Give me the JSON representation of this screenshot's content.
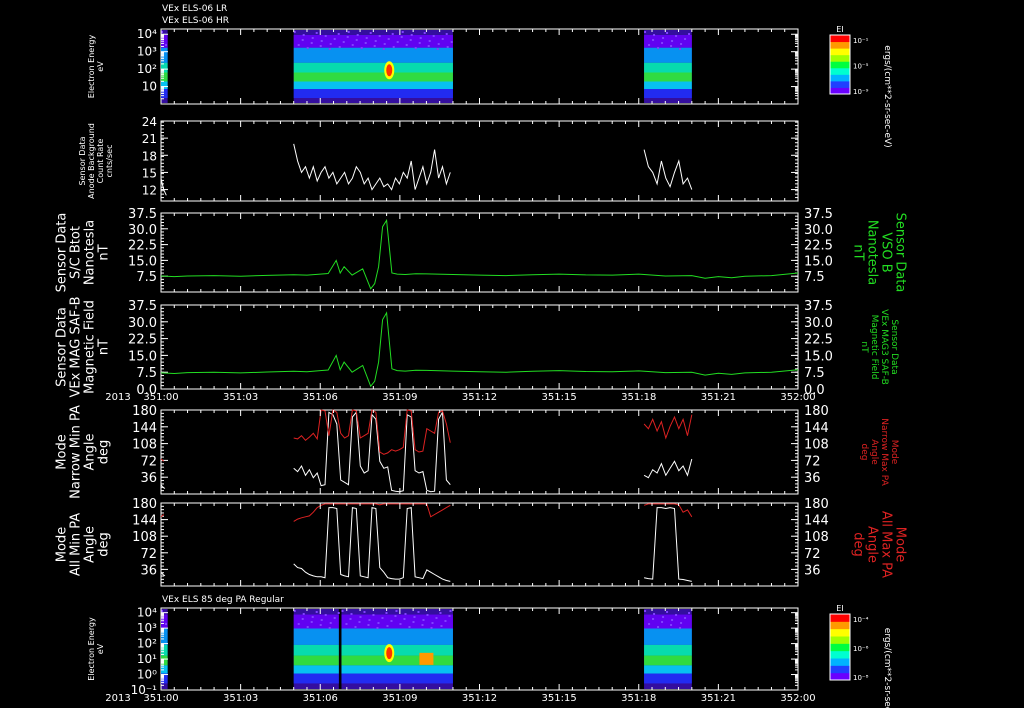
{
  "header": {
    "line1": "VEx ELS-06 LR",
    "line2": "VEx ELS-06 HR"
  },
  "colors": {
    "white": "#ffffff",
    "green": "#22dd22",
    "red": "#dd2222",
    "background": "#000000"
  },
  "time_axis": {
    "year_label": "2013",
    "ticks": [
      "351:00",
      "351:03",
      "351:06",
      "351:09",
      "351:12",
      "351:15",
      "351:18",
      "351:21",
      "352:00"
    ],
    "tick_hours": [
      0,
      3,
      6,
      9,
      12,
      15,
      18,
      21,
      24
    ],
    "range": [
      0,
      24
    ]
  },
  "chart_data": [
    {
      "type": "heatmap",
      "id": "els-lr-hr",
      "ylabel_lines": [
        "Electron Energy",
        "eV"
      ],
      "y_scale": "log",
      "ylim": [
        1,
        20000
      ],
      "y_ticks": [
        "10",
        "10²",
        "10³",
        "10⁴"
      ],
      "y_tick_values": [
        10,
        100,
        1000,
        10000
      ],
      "data_intervals_hours": [
        [
          0,
          0.25
        ],
        [
          5.0,
          11.0
        ],
        [
          18.2,
          20.0
        ]
      ],
      "colorbar": {
        "title": "EI",
        "unit": "ergs/(cm**2-sr-sec-eV)",
        "tick_labels": [
          "10⁻¹",
          "10⁻⁵",
          "10⁻⁹"
        ]
      }
    },
    {
      "type": "line",
      "id": "anode-background",
      "ylabel_lines": [
        "Sensor Data",
        "Anode Background",
        "Count Rate",
        "cnts/sec"
      ],
      "ylim": [
        10,
        24
      ],
      "y_ticks": [
        12,
        15,
        18,
        21,
        24
      ],
      "series": [
        {
          "color": "white",
          "segments": [
            {
              "start": 0.0,
              "end": 0.2,
              "values": [
                14,
                13,
                12,
                11.5,
                11
              ]
            },
            {
              "start": 5.0,
              "end": 10.9,
              "values": [
                20,
                17,
                15,
                16,
                14,
                16,
                13.5,
                15,
                16,
                14,
                15,
                13,
                14,
                15,
                13,
                14,
                16,
                15,
                13,
                14,
                12,
                13,
                14,
                12.5,
                13,
                12,
                14,
                13,
                15,
                14,
                17,
                12,
                14,
                16,
                13,
                15,
                19,
                14,
                16,
                13,
                15
              ]
            },
            {
              "start": 18.2,
              "end": 20.0,
              "values": [
                19,
                16,
                15,
                13,
                17,
                14,
                12.5,
                15,
                17,
                13,
                14,
                12
              ]
            }
          ]
        }
      ]
    },
    {
      "type": "line",
      "id": "sc-btot",
      "ylabel_lines": [
        "Sensor Data",
        "S/C Btot",
        "Nanotesla",
        "nT"
      ],
      "right_label_lines": [
        "Sensor Data",
        "VSO B",
        "Nanotesla",
        "nT"
      ],
      "ylim": [
        0,
        37.5
      ],
      "y_ticks": [
        7.5,
        15.0,
        22.5,
        30.0,
        37.5
      ],
      "series": [
        {
          "color": "green",
          "x": [
            0,
            0.5,
            1,
            2,
            3,
            4,
            5,
            5.5,
            6,
            6.3,
            6.6,
            6.75,
            6.9,
            7.2,
            7.6,
            7.9,
            8.05,
            8.2,
            8.35,
            8.5,
            8.7,
            8.9,
            9.2,
            9.6,
            10,
            11,
            12,
            13,
            14,
            15,
            16,
            17,
            18,
            19,
            20,
            20.5,
            21,
            21.5,
            22,
            23,
            24
          ],
          "values": [
            7.6,
            7.3,
            7.6,
            7.8,
            7.5,
            7.9,
            8.2,
            8.0,
            8.5,
            8.8,
            15,
            9,
            12,
            8,
            11,
            1.5,
            4,
            12,
            31,
            34,
            9,
            8.5,
            8.3,
            8.7,
            8.6,
            8.3,
            8.0,
            7.8,
            8.2,
            8.5,
            8.1,
            8.0,
            8.5,
            7.6,
            7.8,
            6.5,
            7.3,
            6.8,
            7.5,
            7.8,
            9.0
          ]
        }
      ]
    },
    {
      "type": "line",
      "id": "mag-saf-b",
      "ylabel_lines": [
        "Sensor Data",
        "VEx MAG SAF-B",
        "Magnetic Field",
        "nT"
      ],
      "right_label_lines": [
        "Sensor Data",
        "VEx MAG3 SAF-B",
        "Magnetic Field",
        "nT"
      ],
      "ylim": [
        0,
        37.5
      ],
      "y_ticks": [
        0.0,
        7.5,
        15.0,
        22.5,
        30.0,
        37.5
      ],
      "series": [
        {
          "color": "green",
          "x": [
            0,
            0.5,
            1,
            2,
            3,
            4,
            5,
            5.5,
            6,
            6.3,
            6.6,
            6.75,
            6.9,
            7.2,
            7.6,
            7.9,
            8.05,
            8.2,
            8.35,
            8.5,
            8.7,
            8.9,
            9.2,
            9.6,
            10,
            11,
            12,
            13,
            14,
            15,
            16,
            17,
            18,
            19,
            20,
            20.5,
            21,
            21.5,
            22,
            23,
            24
          ],
          "values": [
            7.2,
            6.9,
            7.3,
            7.5,
            7.2,
            7.6,
            7.9,
            7.7,
            8.2,
            8.5,
            15,
            8.6,
            12,
            7.5,
            10.5,
            1.2,
            3.5,
            12,
            31,
            34,
            9,
            8.2,
            8.0,
            8.4,
            8.3,
            8.0,
            7.7,
            7.5,
            7.9,
            8.2,
            7.8,
            7.7,
            8.1,
            7.3,
            7.5,
            6.2,
            7.0,
            6.5,
            7.2,
            7.5,
            8.6
          ]
        }
      ]
    },
    {
      "type": "line",
      "id": "narrow-pa",
      "ylabel_lines": [
        "Mode",
        "Narrow Min PA",
        "Angle",
        "deg"
      ],
      "right_label_lines": [
        "Mode",
        "Narrow Max PA",
        "Angle",
        "deg"
      ],
      "ylim": [
        0,
        180
      ],
      "y_ticks": [
        36,
        72,
        108,
        144,
        180
      ],
      "series": [
        {
          "color": "white",
          "segments": [
            {
              "start": 0.0,
              "end": 0.15,
              "values": [
                20,
                14,
                12
              ]
            },
            {
              "start": 5.0,
              "end": 10.9,
              "values": [
                55,
                48,
                60,
                40,
                52,
                35,
                45,
                18,
                20,
                175,
                170,
                150,
                30,
                25,
                20,
                165,
                175,
                60,
                45,
                50,
                170,
                160,
                70,
                55,
                58,
                8,
                6,
                5,
                7,
                170,
                165,
                50,
                45,
                48,
                8,
                5,
                6,
                160,
                175,
                30,
                20
              ]
            },
            {
              "start": 18.2,
              "end": 20.0,
              "values": [
                40,
                35,
                52,
                45,
                65,
                40,
                55,
                70,
                50,
                60,
                40,
                75
              ]
            }
          ]
        },
        {
          "color": "red",
          "segments": [
            {
              "start": 0.0,
              "end": 0.1,
              "values": [
                75,
                70
              ]
            },
            {
              "start": 5.0,
              "end": 10.9,
              "values": [
                120,
                118,
                125,
                115,
                122,
                130,
                118,
                180,
                178,
                125,
                180,
                175,
                130,
                120,
                125,
                180,
                178,
                120,
                125,
                130,
                180,
                175,
                90,
                85,
                88,
                95,
                92,
                95,
                100,
                180,
                178,
                95,
                90,
                92,
                140,
                135,
                130,
                175,
                178,
                150,
                110
              ]
            },
            {
              "start": 18.2,
              "end": 20.0,
              "values": [
                150,
                140,
                160,
                135,
                155,
                120,
                145,
                165,
                140,
                160,
                125,
                170
              ]
            }
          ]
        }
      ]
    },
    {
      "type": "line",
      "id": "all-pa",
      "ylabel_lines": [
        "Mode",
        "All Min PA",
        "Angle",
        "deg"
      ],
      "right_label_lines": [
        "Mode",
        "All Max PA",
        "Angle",
        "deg"
      ],
      "ylim": [
        0,
        180
      ],
      "y_ticks": [
        36,
        72,
        108,
        144,
        180
      ],
      "series": [
        {
          "color": "white",
          "segments": [
            {
              "start": 0.0,
              "end": 0.15,
              "values": [
                30,
                25,
                22
              ]
            },
            {
              "start": 5.0,
              "end": 10.9,
              "values": [
                48,
                40,
                38,
                30,
                25,
                22,
                20,
                20,
                18,
                170,
                170,
                168,
                25,
                22,
                20,
                170,
                168,
                22,
                20,
                18,
                170,
                168,
                40,
                30,
                18,
                16,
                15,
                15,
                18,
                168,
                170,
                20,
                18,
                16,
                35,
                30,
                25,
                20,
                15,
                12,
                10
              ]
            },
            {
              "start": 18.2,
              "end": 20.0,
              "values": [
                18,
                16,
                15,
                170,
                170,
                168,
                170,
                168,
                15,
                14,
                12,
                10
              ]
            }
          ]
        },
        {
          "color": "red",
          "segments": [
            {
              "start": 0.0,
              "end": 0.1,
              "values": [
                150,
                155
              ]
            },
            {
              "start": 5.0,
              "end": 10.9,
              "values": [
                140,
                145,
                148,
                150,
                152,
                160,
                170,
                175,
                178,
                178,
                178,
                178,
                178,
                178,
                178,
                178,
                178,
                178,
                178,
                178,
                178,
                178,
                176,
                178,
                178,
                178,
                178,
                178,
                178,
                178,
                178,
                178,
                178,
                178,
                178,
                150,
                155,
                160,
                165,
                170,
                175
              ]
            },
            {
              "start": 18.2,
              "end": 20.0,
              "values": [
                175,
                178,
                178,
                178,
                178,
                178,
                178,
                178,
                176,
                160,
                165,
                150
              ]
            }
          ]
        }
      ]
    },
    {
      "type": "heatmap",
      "id": "els-85deg",
      "title": "VEx ELS 85 deg PA Regular",
      "ylabel_lines": [
        "Electron Energy",
        "eV"
      ],
      "y_scale": "log",
      "ylim": [
        0.1,
        20000
      ],
      "y_ticks": [
        "10⁻¹",
        "10⁰",
        "10¹",
        "10²",
        "10³",
        "10⁴"
      ],
      "y_tick_values": [
        0.1,
        1,
        10,
        100,
        1000,
        10000
      ],
      "data_intervals_hours": [
        [
          0,
          0.25
        ],
        [
          5.0,
          6.7
        ],
        [
          6.8,
          11.0
        ],
        [
          18.2,
          20.0
        ]
      ],
      "colorbar": {
        "title": "EI",
        "unit": "ergs/(cm**2-sr-sec-eV)",
        "tick_labels": [
          "10⁻⁴",
          "10⁻⁶",
          "10⁻⁸"
        ]
      }
    }
  ]
}
